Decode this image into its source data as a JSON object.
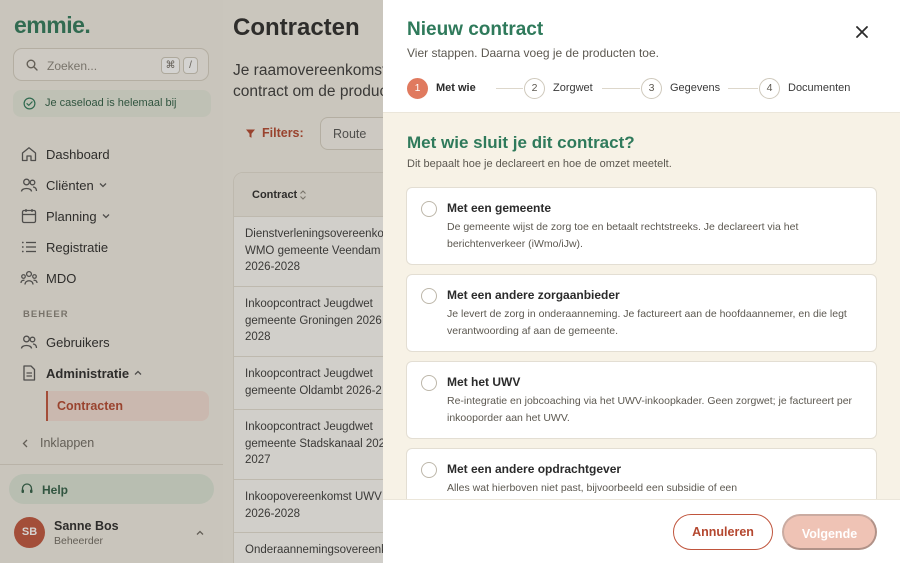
{
  "app": {
    "logo": "emmie."
  },
  "sidebar": {
    "search_placeholder": "Zoeken...",
    "shortcut_keys": [
      "⌘",
      "/"
    ],
    "caseload_status": "Je caseload is helemaal bij",
    "nav": [
      {
        "label": "Dashboard",
        "icon": "home-icon"
      },
      {
        "label": "Cliënten",
        "icon": "users-icon"
      },
      {
        "label": "Planning",
        "icon": "calendar-icon"
      },
      {
        "label": "Registratie",
        "icon": "list-icon"
      },
      {
        "label": "MDO",
        "icon": "group-icon"
      }
    ],
    "section_label": "BEHEER",
    "admin_nav": [
      {
        "label": "Gebruikers",
        "icon": "users-icon"
      },
      {
        "label": "Administratie",
        "icon": "document-icon"
      }
    ],
    "active_subitem": "Contracten",
    "collapse_label": "Inklappen",
    "help_label": "Help",
    "user": {
      "initials": "SB",
      "name": "Sanne Bos",
      "role": "Beheerder"
    }
  },
  "main": {
    "title": "Contracten",
    "description_lines": [
      "Je raamovereenkomst",
      "contract om de produc"
    ],
    "filters_label": "Filters:",
    "route_filter": "Route",
    "table": {
      "column_header": "Contract",
      "rows": [
        "Dienstverleningsovereenko\nWMO gemeente Veendam\n2026-2028",
        "Inkoopcontract Jeugdwet\ngemeente Groningen 2026\n2028",
        "Inkoopcontract Jeugdwet\ngemeente Oldambt 2026-2",
        "Inkoopcontract Jeugdwet\ngemeente Stadskanaal 202\n2027",
        "Inkoopovereenkomst UWV\n2026-2028",
        "Onderaannemingsovereenk"
      ]
    }
  },
  "modal": {
    "title": "Nieuw contract",
    "subtitle": "Vier stappen. Daarna voeg je de producten toe.",
    "steps": [
      {
        "number": "1",
        "label": "Met wie"
      },
      {
        "number": "2",
        "label": "Zorgwet"
      },
      {
        "number": "3",
        "label": "Gegevens"
      },
      {
        "number": "4",
        "label": "Documenten"
      }
    ],
    "question_title": "Met wie sluit je dit contract?",
    "question_subtitle": "Dit bepaalt hoe je declareert en hoe de omzet meetelt.",
    "options": [
      {
        "title": "Met een gemeente",
        "description": "De gemeente wijst de zorg toe en betaalt rechtstreeks. Je declareert via het berichtenverkeer (iWmo/iJw)."
      },
      {
        "title": "Met een andere zorgaanbieder",
        "description": "Je levert de zorg in onderaanneming. Je factureert aan de hoofdaannemer, en die legt verantwoording af aan de gemeente."
      },
      {
        "title": "Met het UWV",
        "description": "Re-integratie en jobcoaching via het UWV-inkoopkader. Geen zorgwet; je factureert per inkooporder aan het UWV."
      },
      {
        "title": "Met een andere opdrachtgever",
        "description": "Alles wat hierboven niet past, bijvoorbeeld een subsidie of een"
      }
    ],
    "cancel_label": "Annuleren",
    "next_label": "Volgende"
  },
  "colors": {
    "brand_green": "#2f7a5b",
    "accent": "#c0553d",
    "active_step": "#e07a5f",
    "disabled_button": "#efc3b5"
  }
}
